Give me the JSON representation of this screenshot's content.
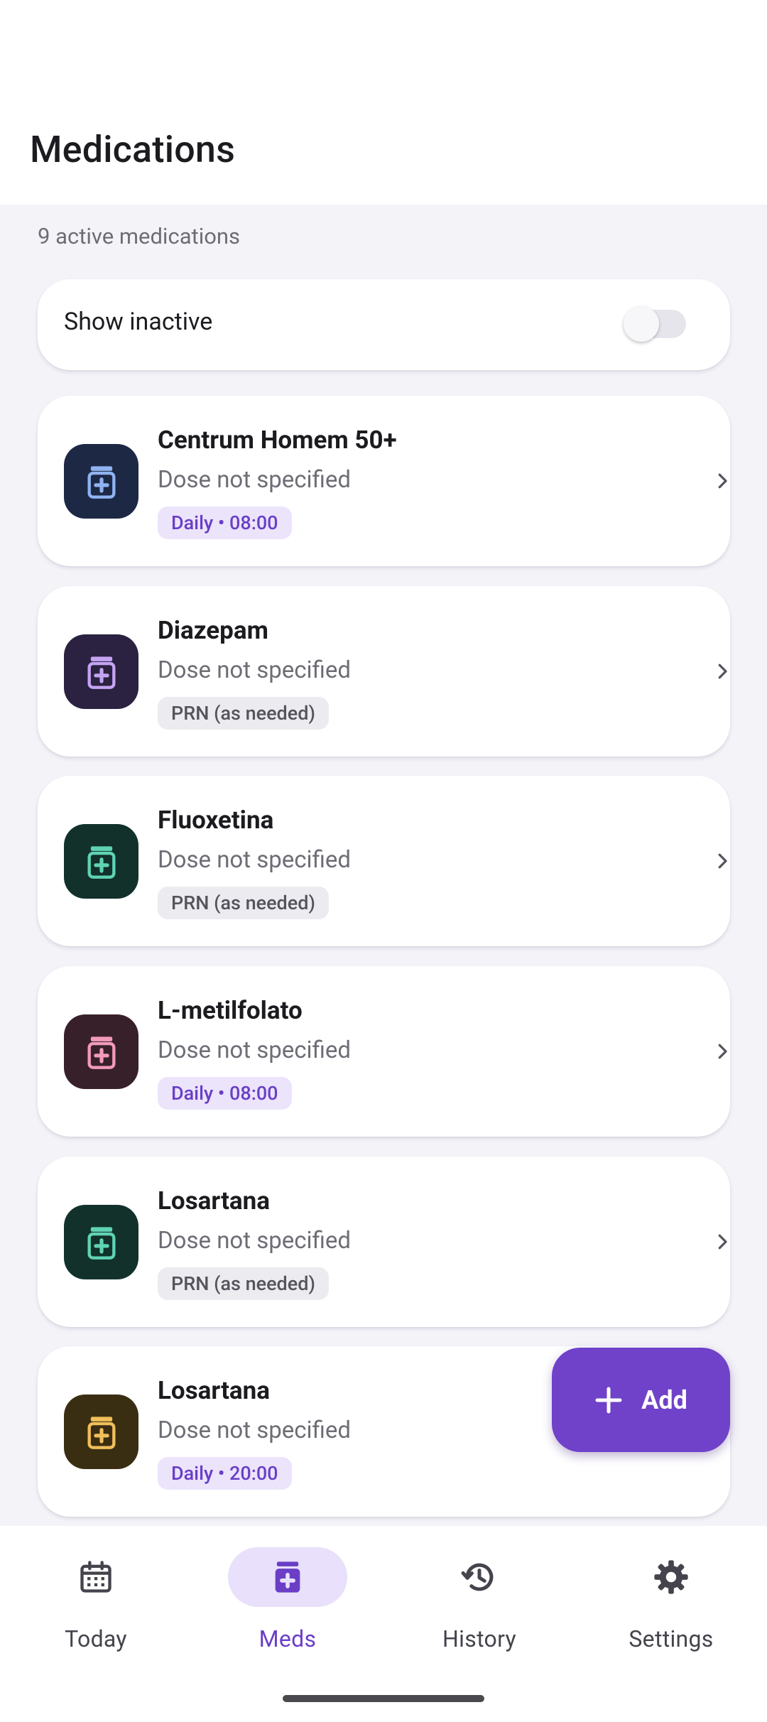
{
  "header": {
    "title": "Medications"
  },
  "summary": {
    "active_count_text": "9 active medications"
  },
  "inactive_toggle": {
    "label": "Show inactive",
    "checked": false
  },
  "medications": [
    {
      "name": "Centrum Homem 50+",
      "dose": "Dose not specified",
      "schedule": "Daily • 08:00",
      "schedule_type": "daily",
      "icon_bg": "#1d2845",
      "icon_color": "#8fb3f2"
    },
    {
      "name": "Diazepam",
      "dose": "Dose not specified",
      "schedule": "PRN (as needed)",
      "schedule_type": "prn",
      "icon_bg": "#2b2140",
      "icon_color": "#c4a3f3"
    },
    {
      "name": "Fluoxetina",
      "dose": "Dose not specified",
      "schedule": "PRN (as needed)",
      "schedule_type": "prn",
      "icon_bg": "#12312b",
      "icon_color": "#5fd3b4"
    },
    {
      "name": "L-metilfolato",
      "dose": "Dose not specified",
      "schedule": "Daily • 08:00",
      "schedule_type": "daily",
      "icon_bg": "#38202b",
      "icon_color": "#f29ab8"
    },
    {
      "name": "Losartana",
      "dose": "Dose not specified",
      "schedule": "PRN (as needed)",
      "schedule_type": "prn",
      "icon_bg": "#12312b",
      "icon_color": "#5fd3b4"
    },
    {
      "name": "Losartana",
      "dose": "Dose not specified",
      "schedule": "Daily • 20:00",
      "schedule_type": "daily",
      "icon_bg": "#3a2e12",
      "icon_color": "#f0bf5a"
    }
  ],
  "fab": {
    "label": "Add",
    "icon": "plus-icon"
  },
  "bottom_nav": [
    {
      "label": "Today",
      "icon": "calendar-icon",
      "active": false
    },
    {
      "label": "Meds",
      "icon": "medicine-bottle-icon",
      "active": true
    },
    {
      "label": "History",
      "icon": "history-icon",
      "active": false
    },
    {
      "label": "Settings",
      "icon": "gear-icon",
      "active": false
    }
  ],
  "colors": {
    "accent": "#6f42c9",
    "background": "#f4f3f8",
    "surface": "#ffffff",
    "chip_daily_bg": "#ebe4fb",
    "chip_prn_bg": "#ecebf0"
  }
}
